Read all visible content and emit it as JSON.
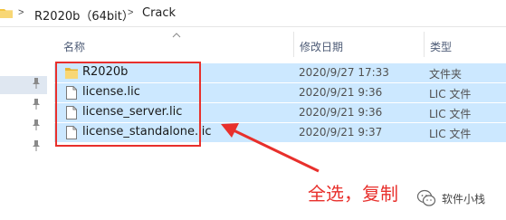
{
  "breadcrumb": {
    "items": [
      "R2020b（64bit）",
      "Crack"
    ]
  },
  "columns": {
    "name": "名称",
    "date": "修改日期",
    "type": "类型"
  },
  "files": [
    {
      "name": "R2020b",
      "date": "2020/9/27 17:33",
      "type": "文件夹",
      "icon": "folder-icon"
    },
    {
      "name": "license.lic",
      "date": "2020/9/21 9:36",
      "type": "LIC 文件",
      "icon": "document-icon"
    },
    {
      "name": "license_server.lic",
      "date": "2020/9/21 9:36",
      "type": "LIC 文件",
      "icon": "document-icon"
    },
    {
      "name": "license_standalone.lic",
      "date": "2020/9/21 9:37",
      "type": "LIC 文件",
      "icon": "document-icon"
    }
  ],
  "annotation": "全选，复制",
  "watermark": "软件小栈",
  "colors": {
    "selection": "#cce8ff",
    "annotation_red": "#e8302c",
    "folder": "#f4c542"
  }
}
